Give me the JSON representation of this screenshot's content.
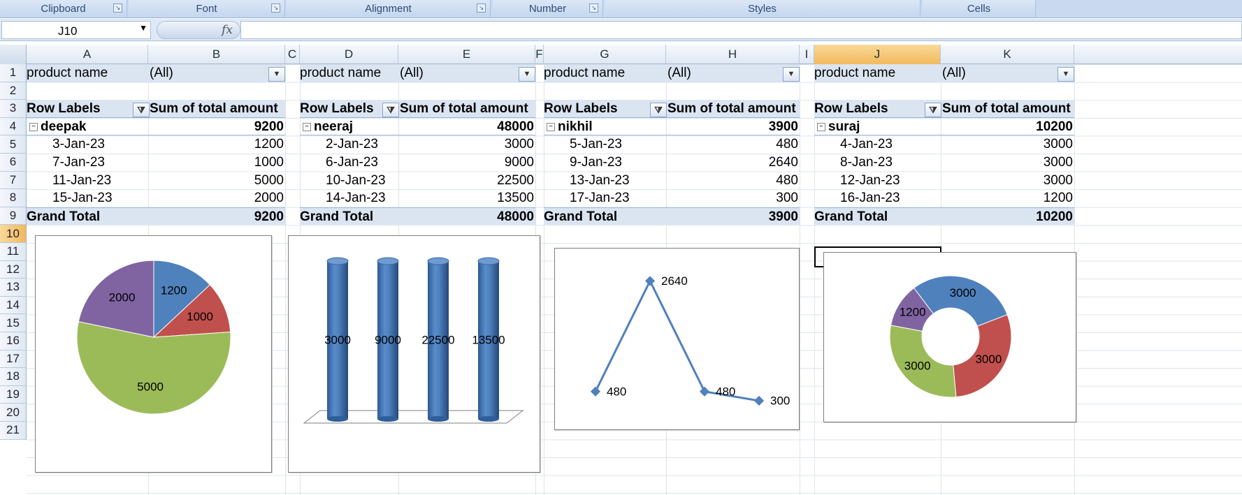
{
  "ribbon": {
    "groups": [
      "Clipboard",
      "Font",
      "Alignment",
      "Number",
      "Styles",
      "Cells"
    ]
  },
  "formula_bar": {
    "name_box": "J10",
    "fx_label": "fx",
    "formula": ""
  },
  "columns": [
    "A",
    "B",
    "C",
    "D",
    "E",
    "F",
    "G",
    "H",
    "I",
    "J",
    "K"
  ],
  "rows": [
    "1",
    "2",
    "3",
    "4",
    "5",
    "6",
    "7",
    "8",
    "9",
    "10",
    "11",
    "12",
    "13",
    "14",
    "15",
    "16",
    "17",
    "18",
    "19",
    "20",
    "21"
  ],
  "selected_cell": "J10",
  "pivots": [
    {
      "filter_label": "product name",
      "filter_value": "(All)",
      "row_labels": "Row Labels",
      "value_header": "Sum of total amount",
      "group": "deepak",
      "group_total": "9200",
      "items": [
        {
          "date": "3-Jan-23",
          "amount": "1200"
        },
        {
          "date": "7-Jan-23",
          "amount": "1000"
        },
        {
          "date": "11-Jan-23",
          "amount": "5000"
        },
        {
          "date": "15-Jan-23",
          "amount": "2000"
        }
      ],
      "grand_total_label": "Grand Total",
      "grand_total": "9200"
    },
    {
      "filter_label": "product name",
      "filter_value": "(All)",
      "row_labels": "Row Labels",
      "value_header": "Sum of total amount",
      "group": "neeraj",
      "group_total": "48000",
      "items": [
        {
          "date": "2-Jan-23",
          "amount": "3000"
        },
        {
          "date": "6-Jan-23",
          "amount": "9000"
        },
        {
          "date": "10-Jan-23",
          "amount": "22500"
        },
        {
          "date": "14-Jan-23",
          "amount": "13500"
        }
      ],
      "grand_total_label": "Grand Total",
      "grand_total": "48000"
    },
    {
      "filter_label": "product name",
      "filter_value": "(All)",
      "row_labels": "Row Labels",
      "value_header": "Sum of total amount",
      "group": "nikhil",
      "group_total": "3900",
      "items": [
        {
          "date": "5-Jan-23",
          "amount": "480"
        },
        {
          "date": "9-Jan-23",
          "amount": "2640"
        },
        {
          "date": "13-Jan-23",
          "amount": "480"
        },
        {
          "date": "17-Jan-23",
          "amount": "300"
        }
      ],
      "grand_total_label": "Grand Total",
      "grand_total": "3900"
    },
    {
      "filter_label": "product name",
      "filter_value": "(All)",
      "row_labels": "Row Labels",
      "value_header": "Sum of total amount",
      "group": "suraj",
      "group_total": "10200",
      "items": [
        {
          "date": "4-Jan-23",
          "amount": "3000"
        },
        {
          "date": "8-Jan-23",
          "amount": "3000"
        },
        {
          "date": "12-Jan-23",
          "amount": "3000"
        },
        {
          "date": "16-Jan-23",
          "amount": "1200"
        }
      ],
      "grand_total_label": "Grand Total",
      "grand_total": "10200"
    }
  ],
  "chart_data": [
    {
      "type": "pie",
      "categories": [
        "3-Jan-23",
        "7-Jan-23",
        "11-Jan-23",
        "15-Jan-23"
      ],
      "values": [
        1200,
        1000,
        5000,
        2000
      ],
      "colors": [
        "#4f81bd",
        "#c0504d",
        "#9bbb59",
        "#8064a2"
      ],
      "data_labels": [
        "1200",
        "1000",
        "5000",
        "2000"
      ]
    },
    {
      "type": "bar",
      "style": "3d-cylinder",
      "categories": [
        "2-Jan-23",
        "6-Jan-23",
        "10-Jan-23",
        "14-Jan-23"
      ],
      "values": [
        3000,
        9000,
        22500,
        13500
      ],
      "color": "#4f81bd",
      "data_labels": [
        "3000",
        "9000",
        "22500",
        "13500"
      ]
    },
    {
      "type": "line",
      "categories": [
        "5-Jan-23",
        "9-Jan-23",
        "13-Jan-23",
        "17-Jan-23"
      ],
      "values": [
        480,
        2640,
        480,
        300
      ],
      "ylim": [
        0,
        3000
      ],
      "color": "#4f81bd",
      "data_labels": [
        "480",
        "2640",
        "480",
        "300"
      ]
    },
    {
      "type": "doughnut",
      "categories": [
        "4-Jan-23",
        "8-Jan-23",
        "12-Jan-23",
        "16-Jan-23"
      ],
      "values": [
        3000,
        3000,
        3000,
        1200
      ],
      "colors": [
        "#4f81bd",
        "#c0504d",
        "#9bbb59",
        "#8064a2"
      ],
      "data_labels": [
        "3000",
        "3000",
        "3000",
        "1200"
      ]
    }
  ]
}
